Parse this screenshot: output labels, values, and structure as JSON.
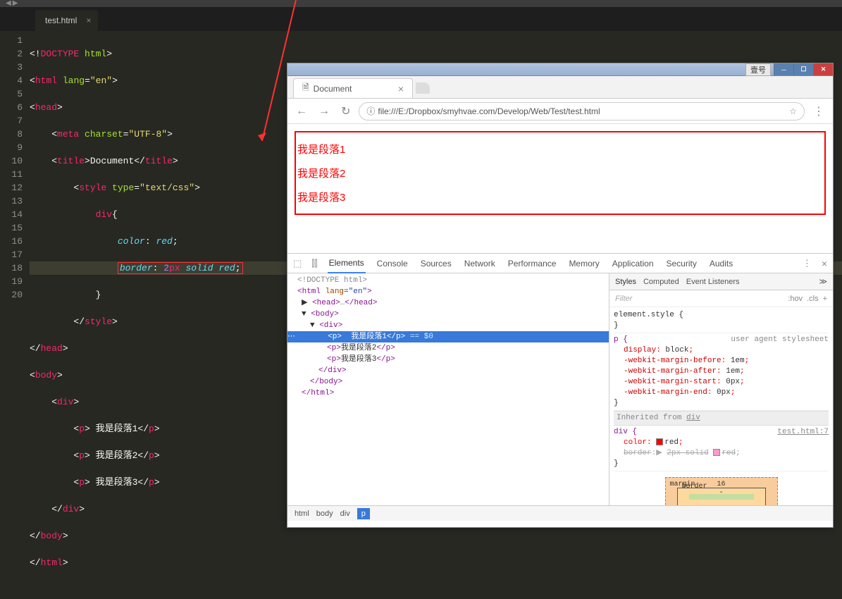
{
  "editor": {
    "tab_name": "test.html",
    "lines": [
      "1",
      "2",
      "3",
      "4",
      "5",
      "6",
      "7",
      "8",
      "9",
      "10",
      "11",
      "12",
      "13",
      "14",
      "15",
      "16",
      "17",
      "18",
      "19",
      "20"
    ],
    "code": {
      "l1": "<!DOCTYPE html>",
      "l2": "<html lang=\"en\">",
      "l3": "<head>",
      "l4": "    <meta charset=\"UTF-8\">",
      "l5": "    <title>Document</title>",
      "l6": "        <style type=\"text/css\">",
      "l7": "            div{",
      "l8": "                color: red;",
      "l9": "                border: 2px solid red;",
      "l10": "            }",
      "l11": "        </style>",
      "l12": "</head>",
      "l13": "<body>",
      "l14": "    <div>",
      "l15": "        <p> 我是段落1</p>",
      "l16": "        <p> 我是段落2</p>",
      "l17": "        <p> 我是段落3</p>",
      "l18": "    </div>",
      "l19": "</body>",
      "l20": "</html>"
    }
  },
  "browser": {
    "titlebar_label": "壹号",
    "tab_title": "Document",
    "url": "file:///E:/Dropbox/smyhvae.com/Develop/Web/Test/test.html",
    "content": {
      "p1": "我是段落1",
      "p2": "我是段落2",
      "p3": "我是段落3"
    }
  },
  "devtools": {
    "tabs": [
      "Elements",
      "Console",
      "Sources",
      "Network",
      "Performance",
      "Memory",
      "Application",
      "Security",
      "Audits"
    ],
    "active_tab": "Elements",
    "elements_tree": {
      "l1": "<!DOCTYPE html>",
      "l2": "<html lang=\"en\">",
      "l3": "<head>…</head>",
      "l4": "<body>",
      "l5": "<div>",
      "l6": "<p>我是段落1</p> == $0",
      "l7": "<p>我是段落2</p>",
      "l8": "<p>我是段落3</p>",
      "l9": "</div>",
      "l10": "</body>",
      "l11": "</html>"
    },
    "breadcrumb": [
      "html",
      "body",
      "div",
      "p"
    ],
    "styles": {
      "tabs": [
        "Styles",
        "Computed",
        "Event Listeners"
      ],
      "filter_placeholder": "Filter",
      "filter_right": [
        ":hov",
        ".cls",
        "+"
      ],
      "element_style": "element.style {",
      "p_rule": {
        "selector": "p {",
        "ua": "user agent stylesheet",
        "props": [
          [
            "display",
            "block"
          ],
          [
            "-webkit-margin-before",
            "1em"
          ],
          [
            "-webkit-margin-after",
            "1em"
          ],
          [
            "-webkit-margin-start",
            "0px"
          ],
          [
            "-webkit-margin-end",
            "0px"
          ]
        ]
      },
      "inherited_label": "Inherited from",
      "inherited_from": "div",
      "div_rule": {
        "selector": "div {",
        "link": "test.html:7",
        "color": "red",
        "border": "2px solid",
        "border_color": "red"
      },
      "box_model": {
        "margin_top": "16",
        "border": "-"
      }
    }
  }
}
